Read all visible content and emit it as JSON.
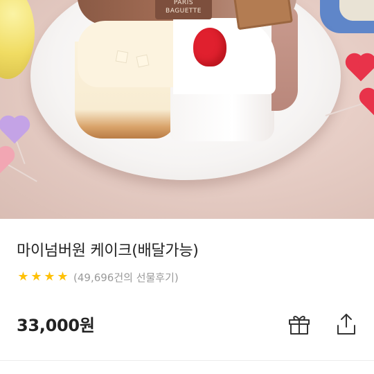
{
  "product_image": {
    "plaque_text_line1": "PARIS",
    "plaque_text_line2": "BAGUETTE"
  },
  "product": {
    "title": "마이넘버원 케이크(배달가능)",
    "rating_stars": 4,
    "review_count_text": "(49,696건의 선물후기)",
    "price": "33,000원"
  },
  "actions": {
    "gift_icon": "gift-icon",
    "share_icon": "share-icon"
  },
  "colors": {
    "star": "#ffc107",
    "text_primary": "#222222",
    "text_secondary": "#9a9a9a"
  }
}
